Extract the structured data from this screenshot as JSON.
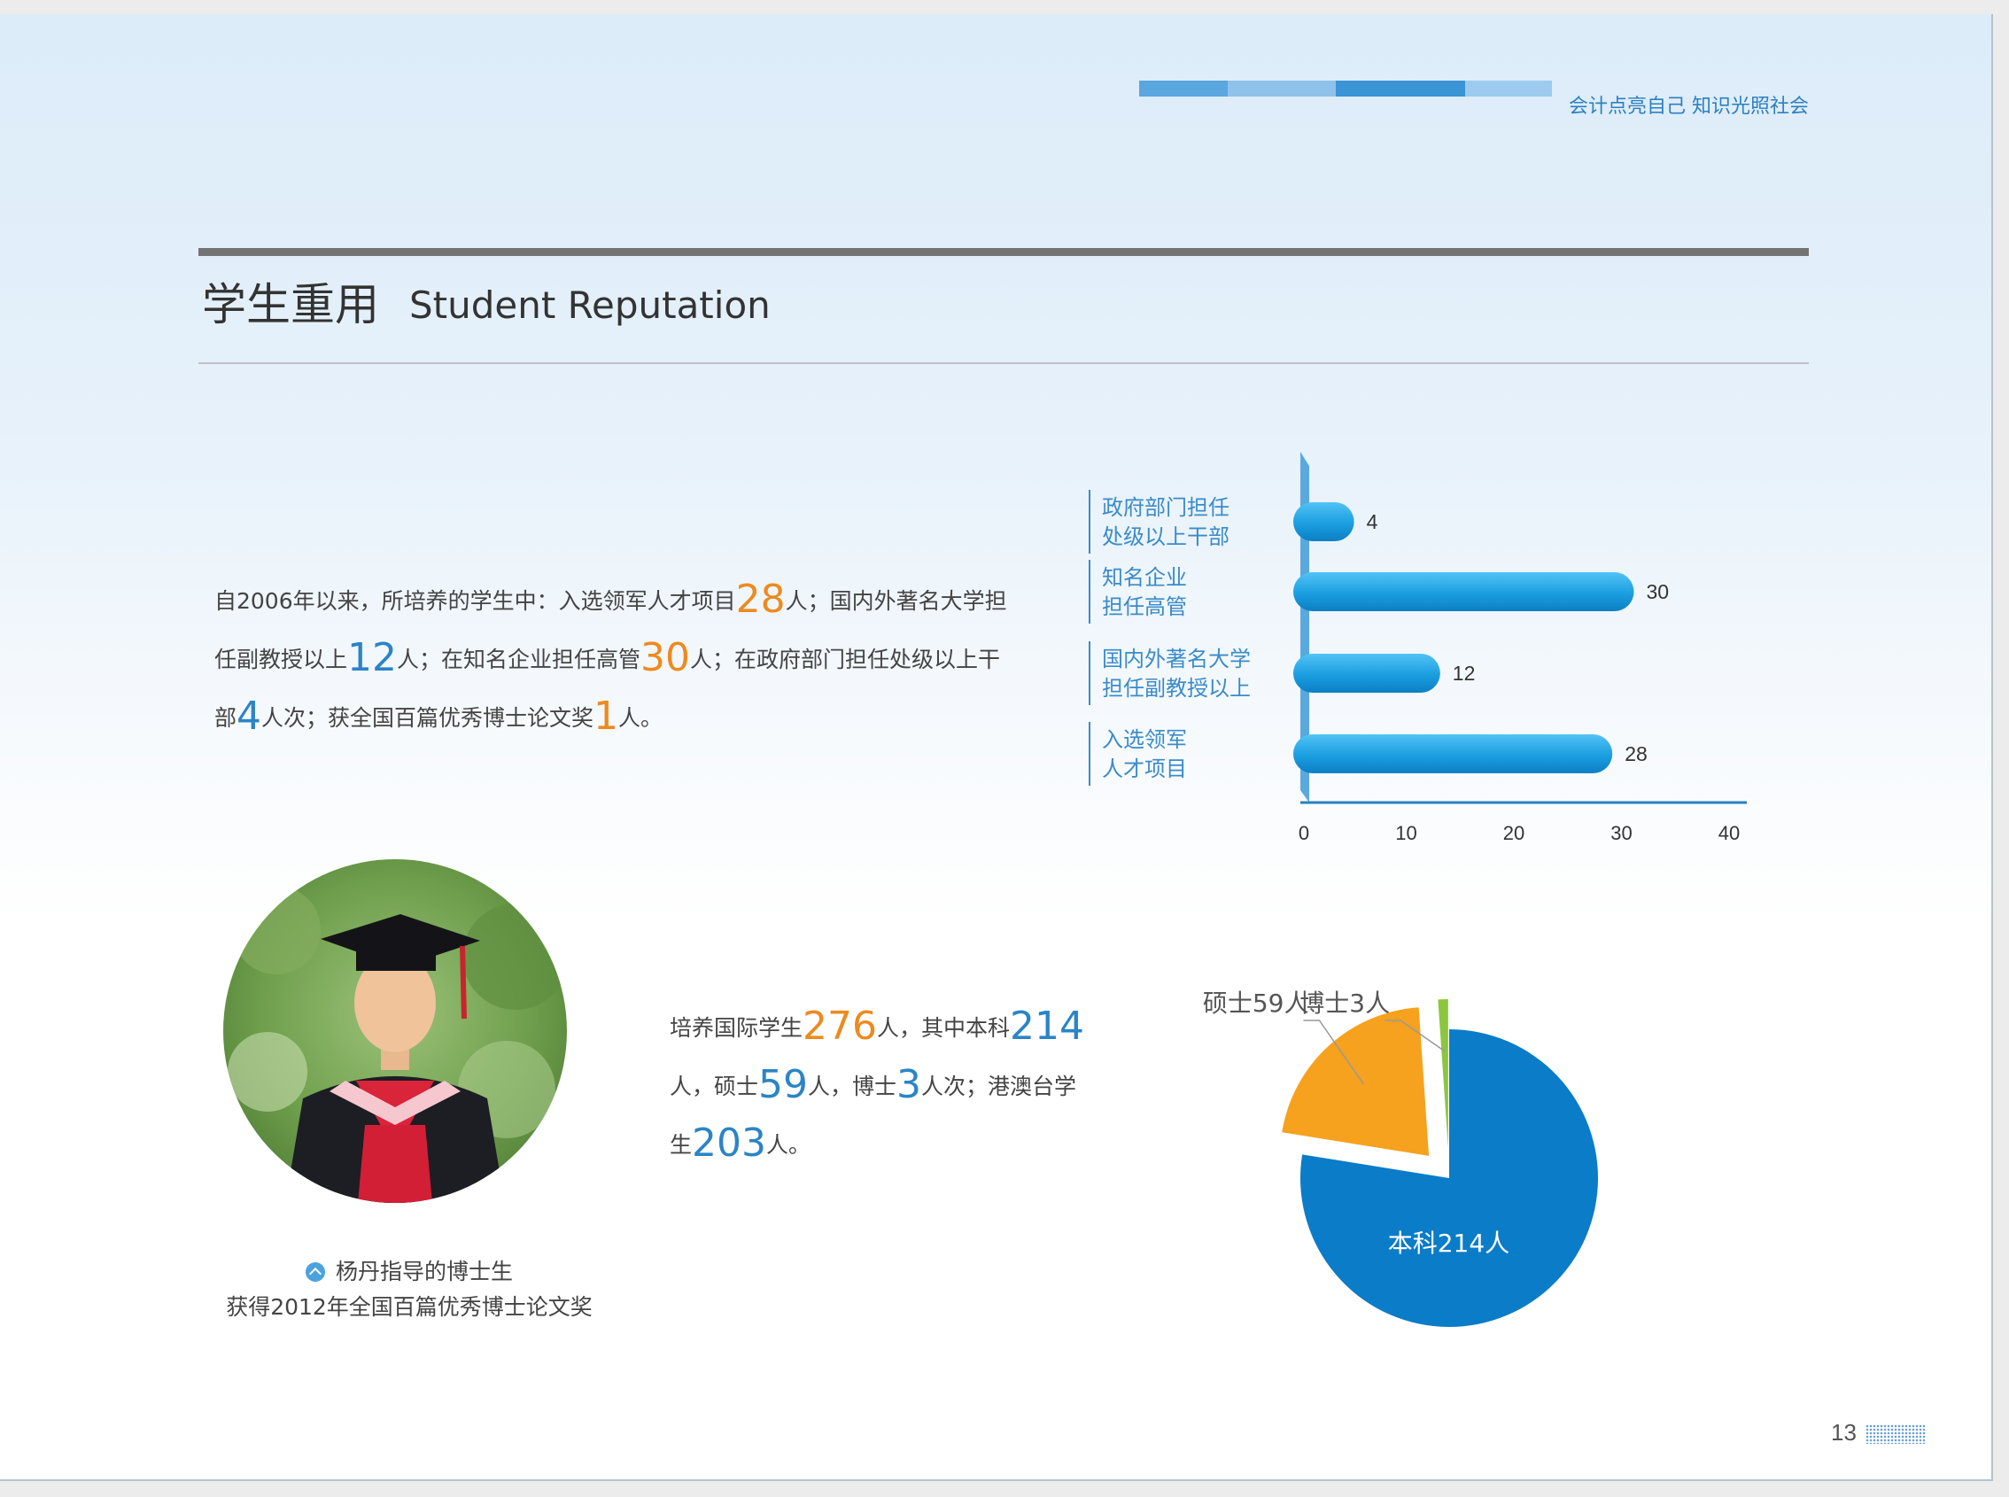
{
  "header": {
    "slogan": "会计点亮自己 知识光照社会",
    "bar_colors": [
      "#5aa6df",
      "#8ec2ea",
      "#3a94d6",
      "#9ccbef"
    ]
  },
  "section": {
    "title_cn": "学生重用",
    "title_en": "Student Reputation"
  },
  "para1": {
    "t1": "自2006年以来，所培养的学生中：入选领军人才项目",
    "n1": "28",
    "t2": "人；国内外著名大学担",
    "t3": "任副教授以上",
    "n2": "12",
    "t4": "人；在知名企业担任高管",
    "n3": "30",
    "t5": "人；在政府部门担任处级以上干",
    "t6": "部",
    "n4": "4",
    "t7": "人次；获全国百篇优秀博士论文奖",
    "n5": "1",
    "t8": "人。"
  },
  "para2": {
    "t1": "培养国际学生",
    "n1": "276",
    "t2": "人，其中本科",
    "n2": "214",
    "t3": "人，硕士",
    "n3": "59",
    "t4": "人，博士",
    "n4": "3",
    "t5": "人次；港澳台学",
    "t6": "生",
    "n5": "203",
    "t7": "人。"
  },
  "photo_caption": {
    "line1": "杨丹指导的博士生",
    "line2": "获得2012年全国百篇优秀博士论文奖"
  },
  "page_number": "13",
  "chart_data": [
    {
      "type": "bar",
      "orientation": "horizontal",
      "categories": [
        [
          "政府部门担任",
          "处级以上干部"
        ],
        [
          "知名企业",
          "担任高管"
        ],
        [
          "国内外著名大学",
          "担任副教授以上"
        ],
        [
          "入选领军",
          "人才项目"
        ]
      ],
      "values": [
        4,
        30,
        12,
        28
      ],
      "value_labels": [
        "4",
        "30",
        "12",
        "28"
      ],
      "xlim": [
        0,
        40
      ],
      "ticks": [
        "0",
        "10",
        "20",
        "30",
        "40"
      ],
      "bar_color": "#1a9ee0",
      "label_color": "#3a8bc9"
    },
    {
      "type": "pie",
      "slices": [
        {
          "label": "本科214人",
          "value": 214,
          "color": "#0a7cc8",
          "exploded": false,
          "label_inside": true
        },
        {
          "label": "硕士59人",
          "value": 59,
          "color": "#f6a21e",
          "exploded": true,
          "label_inside": false
        },
        {
          "label": "博士3人",
          "value": 3,
          "color": "#8cc63f",
          "exploded": true,
          "label_inside": false
        }
      ]
    }
  ]
}
